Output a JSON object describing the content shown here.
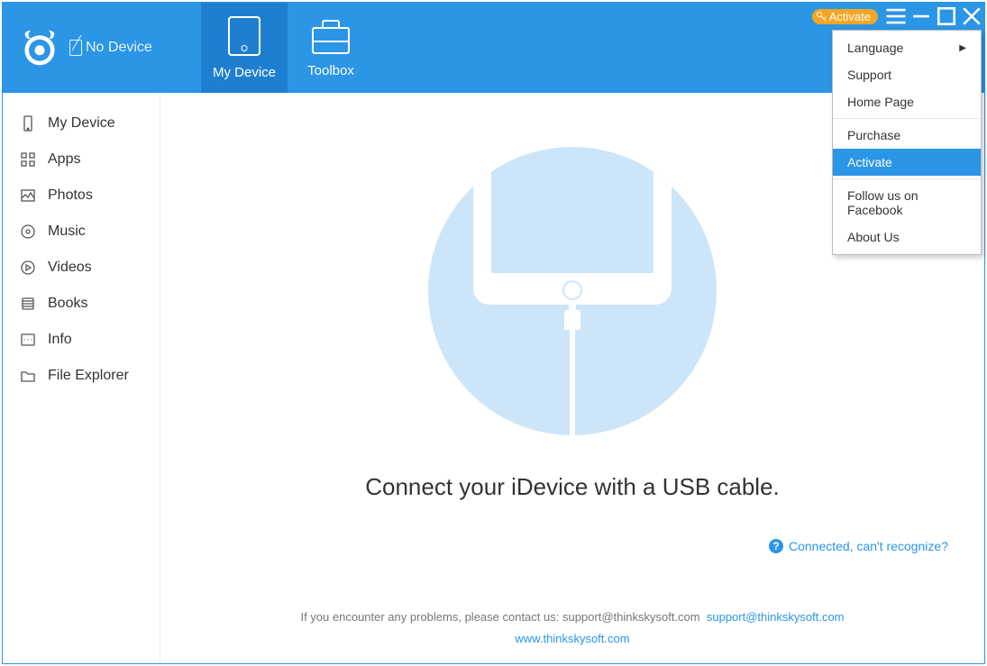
{
  "header": {
    "no_device_label": "No Device",
    "tabs": [
      {
        "label": "My Device"
      },
      {
        "label": "Toolbox"
      }
    ],
    "activate_button": "Activate"
  },
  "sidebar": {
    "items": [
      {
        "label": "My Device",
        "icon": "device-icon"
      },
      {
        "label": "Apps",
        "icon": "apps-icon"
      },
      {
        "label": "Photos",
        "icon": "photos-icon"
      },
      {
        "label": "Music",
        "icon": "music-icon"
      },
      {
        "label": "Videos",
        "icon": "videos-icon"
      },
      {
        "label": "Books",
        "icon": "books-icon"
      },
      {
        "label": "Info",
        "icon": "info-icon"
      },
      {
        "label": "File Explorer",
        "icon": "folder-icon"
      }
    ]
  },
  "main": {
    "connect_headline": "Connect your iDevice with a USB cable.",
    "help_link": "Connected, can't recognize?",
    "footer_intro": "If you encounter any problems, please contact us: support@thinkskysoft.com",
    "footer_email_link": "support@thinkskysoft.com",
    "footer_site_link": "www.thinkskysoft.com"
  },
  "menu": {
    "items": [
      {
        "label": "Language",
        "has_submenu": true
      },
      {
        "label": "Support"
      },
      {
        "label": "Home Page"
      },
      {
        "sep": true
      },
      {
        "label": "Purchase"
      },
      {
        "label": "Activate",
        "highlight": true
      },
      {
        "sep": true
      },
      {
        "label": "Follow us on Facebook"
      },
      {
        "label": "About Us"
      }
    ]
  },
  "colors": {
    "primary": "#2b95e6",
    "accent": "#f5a623"
  }
}
